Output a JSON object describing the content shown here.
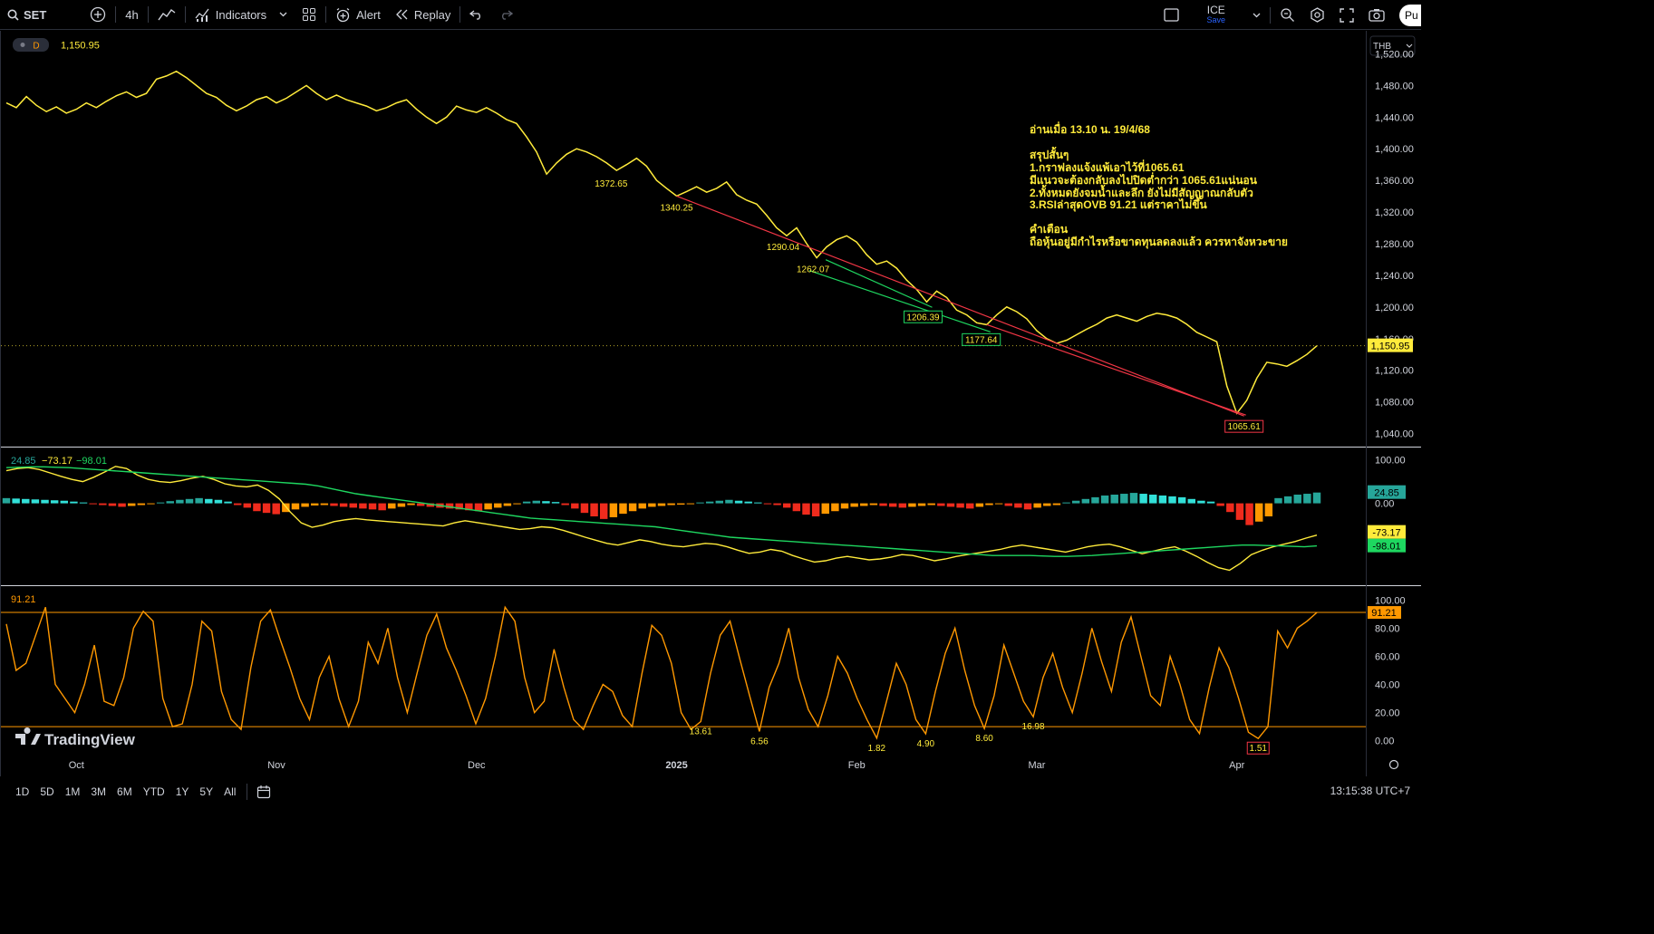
{
  "toolbar": {
    "symbol": "SET",
    "interval": "4h",
    "indicators_label": "Indicators",
    "alert_label": "Alert",
    "replay_label": "Replay",
    "layout_name": "ICE",
    "layout_status": "Save",
    "publish_label": "Pu"
  },
  "legend": {
    "timeframe_badge": "D",
    "price": "1,150.95",
    "currency": "THB"
  },
  "annotation": {
    "lines": [
      "อ่านเมื่อ 13.10 น. 19/4/68",
      "สรุปสั้นๆ",
      "1.กราฟลงแจ้งแพ้เอาไว้ที่1065.61",
      "   มีแนวจะต้องกลับลงไปปิดต่ำกว่า 1065.61แน่นอน",
      "2.ทั้งหมดยังจมน้ำและลึก ยังไม่มีสัญญาณกลับตัว",
      "3.RSIล่าสุดOVB 91.21 แต่ราคาไม่ขึ้น",
      "คำเตือน",
      "ถือหุ้นอยู่มีกำไรหรือขาดทุนลดลงแล้ว ควรหาจังหวะขาย"
    ],
    "color": "#ffeb3b"
  },
  "colors": {
    "price_line": "#ffeb3b",
    "trend_red": "#f23645",
    "trend_green": "#1ed760",
    "rsi_line": "#ff9800",
    "hist_pos": "#26a69a",
    "hist_pos_light": "#32e0d8",
    "hist_neg": "#ef2b1d",
    "hist_neg_light": "#ff9800"
  },
  "chart_data": [
    {
      "type": "line",
      "pane": "price",
      "x_labels": [
        "Oct",
        "Nov",
        "Dec",
        "2025",
        "Feb",
        "Mar",
        "Apr"
      ],
      "y_ticks": [
        "1,520.00",
        "1,480.00",
        "1,440.00",
        "1,400.00",
        "1,360.00",
        "1,320.00",
        "1,280.00",
        "1,240.00",
        "1,200.00",
        "1,160.00",
        "1,120.00",
        "1,080.00",
        "1,040.00"
      ],
      "ylim": [
        1028,
        1540
      ],
      "series": [
        {
          "values": [
            1458,
            1452,
            1466,
            1455,
            1447,
            1453,
            1445,
            1450,
            1458,
            1452,
            1460,
            1467,
            1472,
            1465,
            1470,
            1488,
            1492,
            1498,
            1490,
            1480,
            1470,
            1465,
            1455,
            1448,
            1454,
            1462,
            1466,
            1458,
            1464,
            1472,
            1480,
            1470,
            1462,
            1468,
            1462,
            1458,
            1454,
            1448,
            1452,
            1458,
            1462,
            1450,
            1440,
            1432,
            1440,
            1454,
            1449,
            1446,
            1452,
            1445,
            1437,
            1432,
            1415,
            1396,
            1368,
            1382,
            1393,
            1400,
            1396,
            1390,
            1382,
            1372.65,
            1380,
            1388,
            1378,
            1360,
            1350,
            1340.25,
            1346,
            1352,
            1345,
            1350,
            1358,
            1342,
            1335,
            1330,
            1316,
            1300,
            1290.04,
            1300,
            1280,
            1262.07,
            1276,
            1285,
            1290,
            1282,
            1266,
            1254,
            1258,
            1249,
            1234,
            1222,
            1206.39,
            1220,
            1212,
            1196,
            1190,
            1180,
            1177.64,
            1190,
            1200,
            1194,
            1185,
            1170,
            1160,
            1154,
            1158,
            1165,
            1172,
            1178,
            1186,
            1190,
            1186,
            1182,
            1188,
            1192,
            1190,
            1186,
            1178,
            1168,
            1162,
            1156,
            1100,
            1065.61,
            1082,
            1110,
            1130,
            1128,
            1125,
            1132,
            1140,
            1150.95
          ]
        }
      ],
      "point_labels": [
        "1372.65",
        "1340.25",
        "1290.04",
        "1262.07",
        "1206.39",
        "1177.64",
        "1065.61"
      ],
      "last_value_label": "1,150.95"
    },
    {
      "type": "bar",
      "pane": "oscillator",
      "header_values": [
        "24.85",
        "−73.17",
        "−98.01"
      ],
      "y_ticks": [
        "100.00",
        "0.00"
      ],
      "ylim": [
        -180,
        120
      ],
      "series": [
        {
          "name": "24.85",
          "kind": "histogram",
          "values": [
            12,
            11,
            10,
            9,
            8,
            7,
            6,
            4,
            2,
            -2,
            -4,
            -6,
            -8,
            -6,
            -4,
            -2,
            2,
            5,
            8,
            10,
            12,
            10,
            8,
            4,
            -4,
            -10,
            -18,
            -22,
            -25,
            -20,
            -14,
            -8,
            -5,
            -4,
            -6,
            -8,
            -10,
            -12,
            -14,
            -16,
            -12,
            -8,
            -4,
            -6,
            -8,
            -10,
            -12,
            -14,
            -16,
            -18,
            -14,
            -10,
            -6,
            -2,
            4,
            6,
            5,
            3,
            -4,
            -12,
            -22,
            -30,
            -36,
            -32,
            -24,
            -18,
            -12,
            -8,
            -6,
            -4,
            -3,
            -2,
            2,
            4,
            6,
            8,
            6,
            4,
            2,
            -2,
            -4,
            -10,
            -18,
            -26,
            -30,
            -24,
            -18,
            -12,
            -8,
            -6,
            -4,
            -6,
            -8,
            -10,
            -8,
            -6,
            -4,
            -6,
            -8,
            -10,
            -12,
            -8,
            -4,
            -2,
            -6,
            -10,
            -14,
            -10,
            -6,
            -4,
            2,
            6,
            10,
            14,
            18,
            20,
            22,
            24,
            22,
            20,
            18,
            16,
            14,
            10,
            6,
            4,
            -6,
            -20,
            -38,
            -50,
            -42,
            -30,
            12,
            16,
            20,
            22,
            24.85
          ]
        },
        {
          "name": "−73.17",
          "kind": "line",
          "values": [
            75,
            80,
            82,
            78,
            70,
            62,
            55,
            50,
            60,
            72,
            85,
            80,
            65,
            55,
            50,
            48,
            52,
            58,
            62,
            55,
            45,
            40,
            38,
            42,
            30,
            10,
            -20,
            -45,
            -55,
            -50,
            -42,
            -38,
            -35,
            -38,
            -40,
            -42,
            -44,
            -46,
            -48,
            -50,
            -52,
            -45,
            -40,
            -44,
            -48,
            -52,
            -56,
            -60,
            -58,
            -54,
            -56,
            -62,
            -70,
            -78,
            -85,
            -92,
            -96,
            -90,
            -84,
            -88,
            -94,
            -98,
            -100,
            -96,
            -92,
            -94,
            -100,
            -108,
            -115,
            -112,
            -106,
            -110,
            -120,
            -128,
            -135,
            -132,
            -126,
            -122,
            -126,
            -130,
            -128,
            -124,
            -118,
            -120,
            -126,
            -132,
            -128,
            -122,
            -118,
            -114,
            -110,
            -106,
            -100,
            -96,
            -100,
            -104,
            -108,
            -112,
            -106,
            -100,
            -96,
            -94,
            -100,
            -108,
            -116,
            -110,
            -104,
            -100,
            -110,
            -122,
            -136,
            -148,
            -154,
            -138,
            -118,
            -108,
            -100,
            -94,
            -88,
            -80,
            -73.17
          ]
        },
        {
          "name": "−98.01",
          "kind": "line",
          "values": [
            82,
            83,
            84,
            84,
            83,
            82,
            80,
            78,
            76,
            74,
            72,
            70,
            68,
            66,
            64,
            62,
            60,
            58,
            56,
            54,
            52,
            50,
            48,
            46,
            44,
            40,
            34,
            28,
            22,
            18,
            14,
            10,
            6,
            2,
            -2,
            -6,
            -10,
            -14,
            -18,
            -22,
            -26,
            -30,
            -34,
            -36,
            -38,
            -40,
            -42,
            -44,
            -46,
            -48,
            -50,
            -52,
            -54,
            -58,
            -62,
            -66,
            -70,
            -74,
            -78,
            -80,
            -82,
            -84,
            -86,
            -88,
            -90,
            -92,
            -94,
            -96,
            -98,
            -100,
            -102,
            -104,
            -106,
            -108,
            -110,
            -112,
            -114,
            -116,
            -118,
            -120,
            -120,
            -120,
            -120,
            -121,
            -122,
            -122,
            -121,
            -120,
            -118,
            -116,
            -114,
            -112,
            -110,
            -108,
            -106,
            -104,
            -102,
            -100,
            -98,
            -96,
            -96,
            -97,
            -98,
            -99,
            -100,
            -98.01
          ]
        }
      ],
      "last_value_labels": [
        "24.85",
        "-73.17",
        "-98.01"
      ]
    },
    {
      "type": "line",
      "pane": "rsi",
      "header_value": "91.21",
      "y_ticks": [
        "100.00",
        "80.00",
        "60.00",
        "40.00",
        "20.00",
        "0.00"
      ],
      "ylim": [
        -8,
        108
      ],
      "levels": [
        91.21,
        10
      ],
      "series": [
        {
          "values": [
            83,
            50,
            55,
            75,
            95,
            40,
            30,
            20,
            40,
            68,
            28,
            25,
            45,
            80,
            92,
            85,
            30,
            10,
            12,
            40,
            85,
            78,
            35,
            15,
            8,
            52,
            85,
            93,
            72,
            52,
            30,
            15,
            45,
            60,
            30,
            10,
            28,
            70,
            55,
            80,
            45,
            20,
            48,
            75,
            90,
            66,
            50,
            32,
            12,
            30,
            60,
            95,
            85,
            45,
            20,
            28,
            65,
            38,
            15,
            8,
            25,
            40,
            35,
            18,
            10,
            48,
            82,
            75,
            55,
            20,
            8,
            13.61,
            48,
            75,
            85,
            58,
            32,
            6.56,
            38,
            55,
            80,
            45,
            22,
            10,
            32,
            60,
            48,
            30,
            15,
            1.82,
            28,
            55,
            40,
            15,
            4.9,
            35,
            62,
            80,
            50,
            25,
            8.6,
            32,
            68,
            48,
            28,
            16.98,
            45,
            62,
            38,
            20,
            48,
            80,
            56,
            35,
            70,
            88,
            60,
            32,
            25,
            60,
            40,
            15,
            5,
            38,
            66,
            52,
            30,
            6,
            1.51,
            10,
            78,
            66,
            80,
            85,
            91.21
          ]
        }
      ],
      "point_labels": [
        "13.61",
        "6.56",
        "1.82",
        "4.90",
        "8.60",
        "16.98",
        "1.51"
      ],
      "last_value_label": "91.21"
    }
  ],
  "watermark": "TradingView",
  "bottom": {
    "ranges": [
      "1D",
      "5D",
      "1M",
      "3M",
      "6M",
      "YTD",
      "1Y",
      "5Y",
      "All"
    ],
    "clock": "13:15:38 UTC+7"
  }
}
